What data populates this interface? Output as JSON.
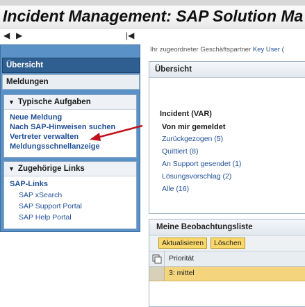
{
  "header": {
    "title": "Incident Management: SAP Solution Ma"
  },
  "nav": {
    "back": "◀",
    "forward": "▶",
    "first": "|◀"
  },
  "sidebar": {
    "uebersicht": "Übersicht",
    "meldungen": "Meldungen",
    "typical_tasks": {
      "title": "Typische Aufgaben",
      "items": [
        "Neue Meldung",
        "Nach SAP-Hinweisen suchen",
        "Vertreter verwalten",
        "Meldungsschnellanzeige"
      ]
    },
    "related_links": {
      "title": "Zugehörige Links",
      "group": "SAP-Links",
      "items": [
        "SAP xSearch",
        "SAP Support Portal",
        "SAP Help Portal"
      ]
    }
  },
  "partner": {
    "label": "Ihr zugeordneter Geschäftspartner",
    "link": "Key User ("
  },
  "overview": {
    "title": "Übersicht",
    "category": "Incident (VAR)",
    "subcategory": "Von mir gemeldet",
    "links": [
      "Zurückgezogen (5)",
      "Quittiert (8)",
      "An Support gesendet (1)",
      "Lösungsvorschlag (2)",
      "Alle (16)"
    ]
  },
  "watchlist": {
    "title": "Meine Beobachtungsliste",
    "buttons": {
      "refresh": "Aktualisieren",
      "delete": "Löschen"
    },
    "columns": [
      "Priorität"
    ],
    "rows": [
      [
        "3: mittel"
      ]
    ]
  },
  "colors": {
    "panel_blue": "#5a91c6",
    "selected_nav": "#2f5f90",
    "link": "#1f4f96",
    "button": "#fbd86a",
    "arrow": "#c0141c",
    "row_highlight": "#f4d47c"
  }
}
